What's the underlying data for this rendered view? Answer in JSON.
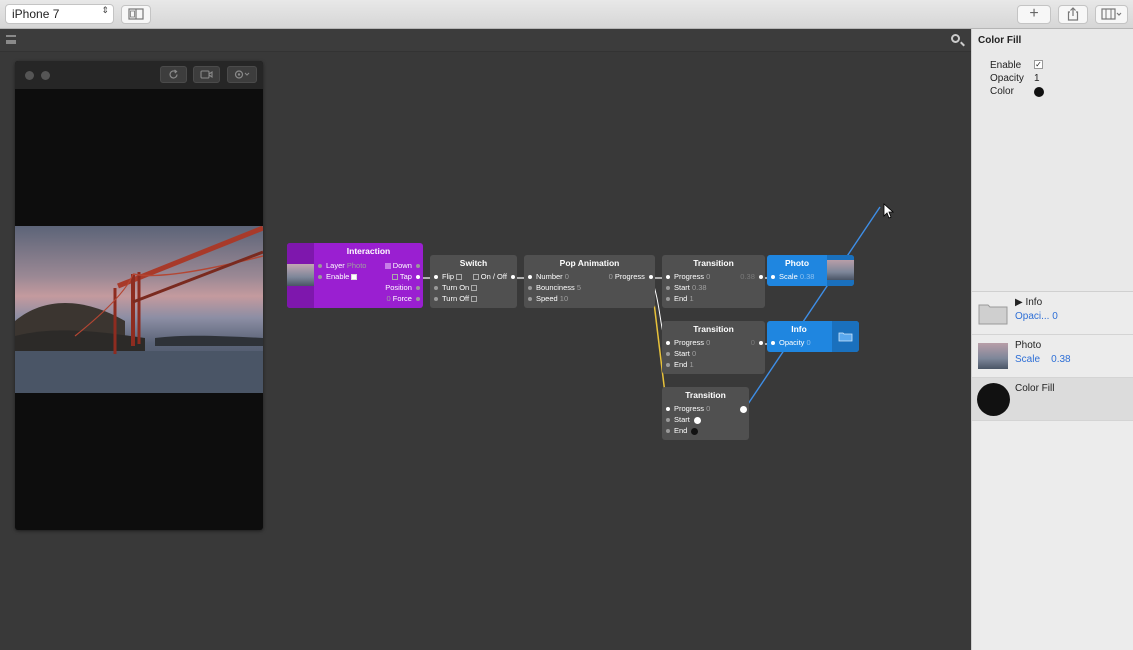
{
  "toolbar": {
    "device": "iPhone 7",
    "device_chevron": "⇕",
    "layout_toggle_icon": "split-view-icon",
    "add_icon": "+",
    "share_icon": "share-icon",
    "panel_toggle_icon": "panel-layout-icon"
  },
  "nodes": {
    "interaction": {
      "title": "Interaction",
      "layer_label": "Layer",
      "layer_value": "Photo",
      "enable_label": "Enable",
      "down_label": "Down",
      "tap_label": "Tap",
      "position_label": "Position",
      "force_label": "Force",
      "force_value": "0"
    },
    "switch": {
      "title": "Switch",
      "flip": "Flip",
      "onoff": "On / Off",
      "turnon": "Turn On",
      "turnoff": "Turn Off"
    },
    "pop": {
      "title": "Pop Animation",
      "number_label": "Number",
      "number_value": "0",
      "bounciness_label": "Bounciness",
      "bounciness_value": "5",
      "speed_label": "Speed",
      "speed_value": "10",
      "progress_label": "Progress",
      "progress_value": "0"
    },
    "transition1": {
      "title": "Transition",
      "progress_label": "Progress",
      "progress_value": "0",
      "start_label": "Start",
      "start_value": "0.38",
      "end_label": "End",
      "end_value": "1",
      "out_value": "0.38"
    },
    "transition2": {
      "title": "Transition",
      "progress_label": "Progress",
      "progress_value": "0",
      "start_label": "Start",
      "start_value": "0",
      "end_label": "End",
      "end_value": "1",
      "out_value": "0"
    },
    "transition3": {
      "title": "Transition",
      "progress_label": "Progress",
      "progress_value": "0",
      "start_label": "Start",
      "end_label": "End"
    },
    "photo": {
      "title": "Photo",
      "scale_label": "Scale",
      "scale_value": "0.38"
    },
    "info": {
      "title": "Info",
      "opacity_label": "Opacity",
      "opacity_value": "0"
    }
  },
  "inspector": {
    "title": "Color Fill",
    "enable_label": "Enable",
    "opacity_label": "Opacity",
    "opacity_value": "1",
    "color_label": "Color",
    "color_value": "#111111"
  },
  "layers": [
    {
      "name": "Info",
      "sub_label": "Opaci...",
      "sub_value": "0"
    },
    {
      "name": "Photo",
      "sub_label": "Scale",
      "sub_value": "0.38"
    },
    {
      "name": "Color Fill"
    }
  ],
  "colors": {
    "interaction_node": "#9a1fd1",
    "layer_node": "#1f86e0",
    "patch_node": "#525252",
    "link": "#ffffff",
    "animated_link": "#e8c23a",
    "selected_link": "#3e8ee6"
  }
}
